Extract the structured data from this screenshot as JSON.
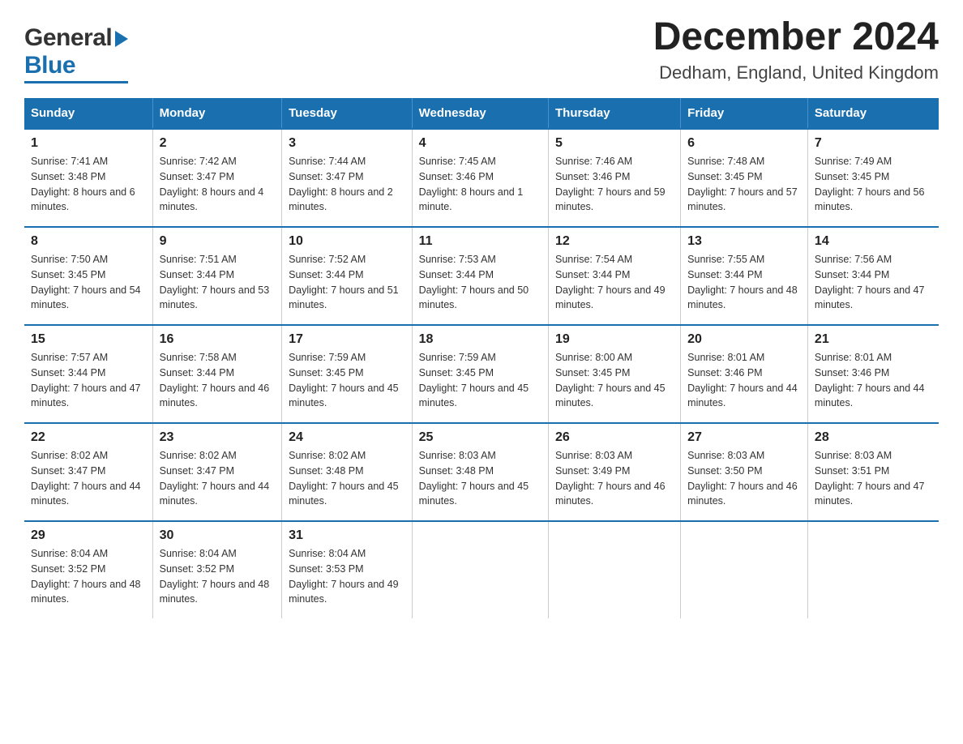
{
  "header": {
    "logo_general": "General",
    "logo_blue": "Blue",
    "month_title": "December 2024",
    "location": "Dedham, England, United Kingdom"
  },
  "days_of_week": [
    "Sunday",
    "Monday",
    "Tuesday",
    "Wednesday",
    "Thursday",
    "Friday",
    "Saturday"
  ],
  "weeks": [
    [
      {
        "day": "1",
        "sunrise": "7:41 AM",
        "sunset": "3:48 PM",
        "daylight": "8 hours and 6 minutes."
      },
      {
        "day": "2",
        "sunrise": "7:42 AM",
        "sunset": "3:47 PM",
        "daylight": "8 hours and 4 minutes."
      },
      {
        "day": "3",
        "sunrise": "7:44 AM",
        "sunset": "3:47 PM",
        "daylight": "8 hours and 2 minutes."
      },
      {
        "day": "4",
        "sunrise": "7:45 AM",
        "sunset": "3:46 PM",
        "daylight": "8 hours and 1 minute."
      },
      {
        "day": "5",
        "sunrise": "7:46 AM",
        "sunset": "3:46 PM",
        "daylight": "7 hours and 59 minutes."
      },
      {
        "day": "6",
        "sunrise": "7:48 AM",
        "sunset": "3:45 PM",
        "daylight": "7 hours and 57 minutes."
      },
      {
        "day": "7",
        "sunrise": "7:49 AM",
        "sunset": "3:45 PM",
        "daylight": "7 hours and 56 minutes."
      }
    ],
    [
      {
        "day": "8",
        "sunrise": "7:50 AM",
        "sunset": "3:45 PM",
        "daylight": "7 hours and 54 minutes."
      },
      {
        "day": "9",
        "sunrise": "7:51 AM",
        "sunset": "3:44 PM",
        "daylight": "7 hours and 53 minutes."
      },
      {
        "day": "10",
        "sunrise": "7:52 AM",
        "sunset": "3:44 PM",
        "daylight": "7 hours and 51 minutes."
      },
      {
        "day": "11",
        "sunrise": "7:53 AM",
        "sunset": "3:44 PM",
        "daylight": "7 hours and 50 minutes."
      },
      {
        "day": "12",
        "sunrise": "7:54 AM",
        "sunset": "3:44 PM",
        "daylight": "7 hours and 49 minutes."
      },
      {
        "day": "13",
        "sunrise": "7:55 AM",
        "sunset": "3:44 PM",
        "daylight": "7 hours and 48 minutes."
      },
      {
        "day": "14",
        "sunrise": "7:56 AM",
        "sunset": "3:44 PM",
        "daylight": "7 hours and 47 minutes."
      }
    ],
    [
      {
        "day": "15",
        "sunrise": "7:57 AM",
        "sunset": "3:44 PM",
        "daylight": "7 hours and 47 minutes."
      },
      {
        "day": "16",
        "sunrise": "7:58 AM",
        "sunset": "3:44 PM",
        "daylight": "7 hours and 46 minutes."
      },
      {
        "day": "17",
        "sunrise": "7:59 AM",
        "sunset": "3:45 PM",
        "daylight": "7 hours and 45 minutes."
      },
      {
        "day": "18",
        "sunrise": "7:59 AM",
        "sunset": "3:45 PM",
        "daylight": "7 hours and 45 minutes."
      },
      {
        "day": "19",
        "sunrise": "8:00 AM",
        "sunset": "3:45 PM",
        "daylight": "7 hours and 45 minutes."
      },
      {
        "day": "20",
        "sunrise": "8:01 AM",
        "sunset": "3:46 PM",
        "daylight": "7 hours and 44 minutes."
      },
      {
        "day": "21",
        "sunrise": "8:01 AM",
        "sunset": "3:46 PM",
        "daylight": "7 hours and 44 minutes."
      }
    ],
    [
      {
        "day": "22",
        "sunrise": "8:02 AM",
        "sunset": "3:47 PM",
        "daylight": "7 hours and 44 minutes."
      },
      {
        "day": "23",
        "sunrise": "8:02 AM",
        "sunset": "3:47 PM",
        "daylight": "7 hours and 44 minutes."
      },
      {
        "day": "24",
        "sunrise": "8:02 AM",
        "sunset": "3:48 PM",
        "daylight": "7 hours and 45 minutes."
      },
      {
        "day": "25",
        "sunrise": "8:03 AM",
        "sunset": "3:48 PM",
        "daylight": "7 hours and 45 minutes."
      },
      {
        "day": "26",
        "sunrise": "8:03 AM",
        "sunset": "3:49 PM",
        "daylight": "7 hours and 46 minutes."
      },
      {
        "day": "27",
        "sunrise": "8:03 AM",
        "sunset": "3:50 PM",
        "daylight": "7 hours and 46 minutes."
      },
      {
        "day": "28",
        "sunrise": "8:03 AM",
        "sunset": "3:51 PM",
        "daylight": "7 hours and 47 minutes."
      }
    ],
    [
      {
        "day": "29",
        "sunrise": "8:04 AM",
        "sunset": "3:52 PM",
        "daylight": "7 hours and 48 minutes."
      },
      {
        "day": "30",
        "sunrise": "8:04 AM",
        "sunset": "3:52 PM",
        "daylight": "7 hours and 48 minutes."
      },
      {
        "day": "31",
        "sunrise": "8:04 AM",
        "sunset": "3:53 PM",
        "daylight": "7 hours and 49 minutes."
      },
      null,
      null,
      null,
      null
    ]
  ],
  "labels": {
    "sunrise_prefix": "Sunrise: ",
    "sunset_prefix": "Sunset: ",
    "daylight_prefix": "Daylight: "
  }
}
